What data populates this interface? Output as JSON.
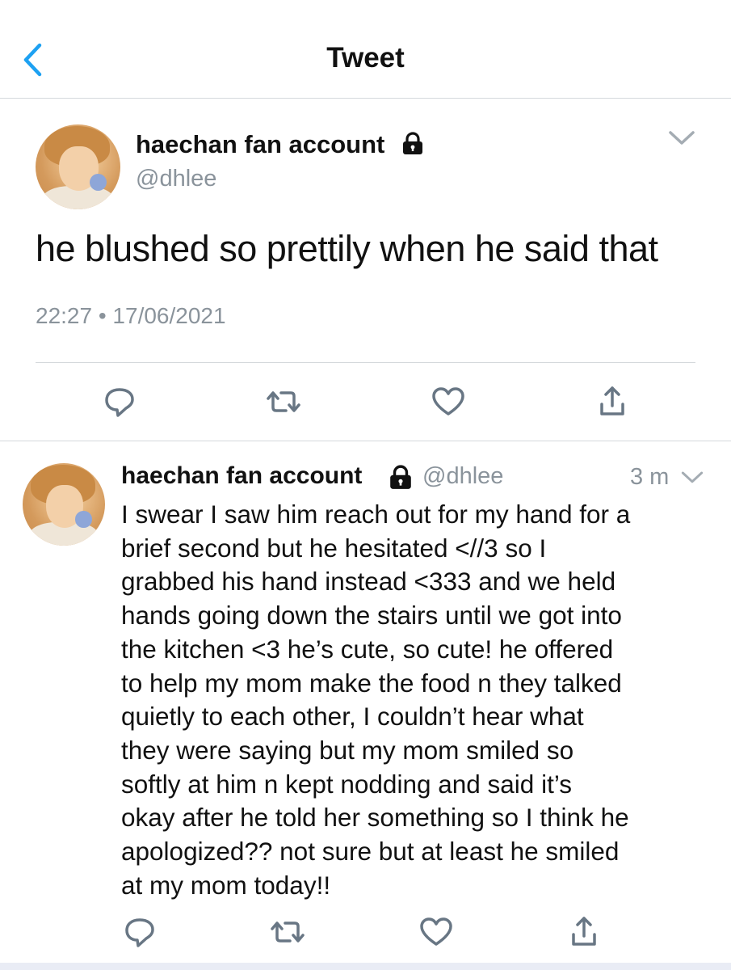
{
  "header": {
    "title": "Tweet",
    "back_icon": "chevron-left-icon"
  },
  "main_tweet": {
    "display_name": "haechan fan account",
    "handle": "@dhlee",
    "protected_icon": "lock-icon",
    "text": "he blushed so prettily when he said that",
    "timestamp": "22:27 • 17/06/2021",
    "actions": [
      "reply-icon",
      "retweet-icon",
      "like-icon",
      "share-icon"
    ]
  },
  "reply_tweet": {
    "display_name": "haechan fan account",
    "handle": "@dhlee",
    "protected_icon": "lock-icon",
    "time": "3 m",
    "lines": [
      "I swear I saw him reach out for my hand for a",
      "brief second but he hesitated <//3 so I",
      "grabbed his hand instead <333 and we held",
      "hands going down the stairs until we got into",
      "the kitchen <3 he’s cute, so cute! he offered",
      "to help my mom make the food n they talked",
      "quietly to each other, I couldn’t hear what",
      "they were saying but my mom smiled so",
      "softly at him n kept nodding and said it’s",
      "okay after he told her something so I think he",
      "apologized?? not sure but at least he smiled",
      "at my mom today!!"
    ],
    "actions": [
      "reply-icon",
      "retweet-icon",
      "like-icon",
      "share-icon"
    ]
  },
  "colors": {
    "accent": "#1da1f2",
    "muted": "#8a939b",
    "divider": "#d5d9dc",
    "icon": "#687684"
  }
}
